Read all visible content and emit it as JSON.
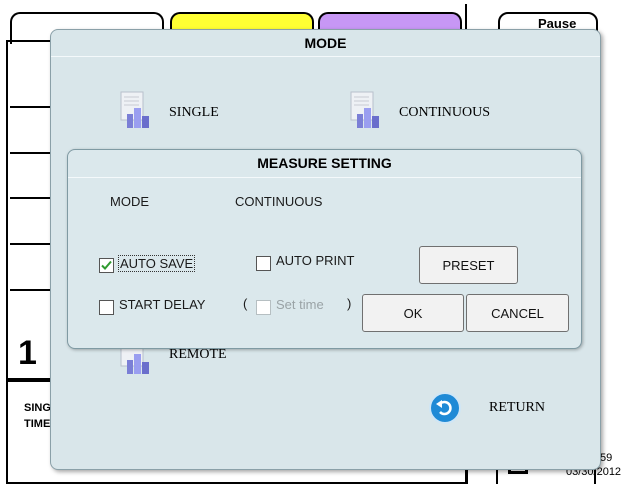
{
  "background": {
    "pause_label": "Pause",
    "big_digit": "1",
    "bottom_left_line1": "SING",
    "bottom_left_line2": "TIME",
    "clock_fragment": "59",
    "date": "03/30/2012",
    "tab_colors": [
      "#ffffff",
      "#ffff33",
      "#c797f5"
    ]
  },
  "mode_dialog": {
    "title": "MODE",
    "buttons": [
      {
        "label": "SINGLE",
        "icon": "bar-chart-document-icon"
      },
      {
        "label": "CONTINUOUS",
        "icon": "bar-chart-document-icon"
      },
      {
        "label": "REMOTE",
        "icon": "bar-chart-document-icon"
      }
    ],
    "return_label": "RETURN"
  },
  "measure_setting": {
    "title": "MEASURE SETTING",
    "mode_label": "MODE",
    "mode_value": "CONTINUOUS",
    "auto_save": {
      "label": "AUTO SAVE",
      "checked": true
    },
    "auto_print": {
      "label": "AUTO PRINT",
      "checked": false
    },
    "start_delay": {
      "label": "START DELAY",
      "checked": false
    },
    "set_time": {
      "label": "Set time",
      "checked": false,
      "enabled": false
    },
    "paren_open": "(",
    "paren_close": ")",
    "preset_label": "PRESET",
    "ok_label": "OK",
    "cancel_label": "CANCEL"
  }
}
